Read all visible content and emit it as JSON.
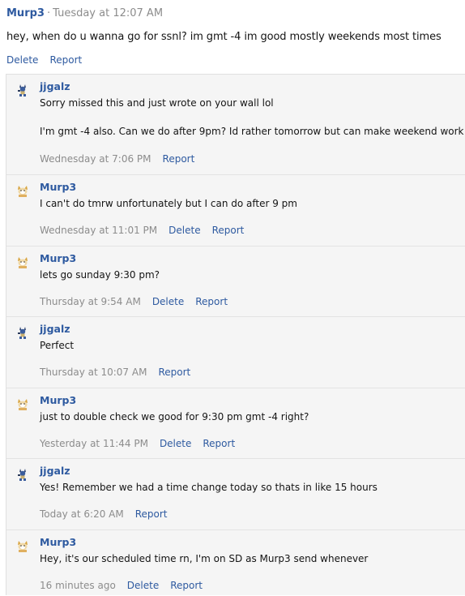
{
  "post": {
    "author": "Murp3",
    "separator": "·",
    "time": "Tuesday at 12:07 AM",
    "body": "hey, when do u wanna go for ssnl? im gmt -4 im good mostly weekends most times",
    "delete_label": "Delete",
    "report_label": "Report"
  },
  "comments": [
    {
      "author": "jjgalz",
      "avatar_icon": "lucario-avatar-icon",
      "line1": "Sorry missed this and just wrote on your wall lol",
      "line2": "I'm gmt -4 also. Can we do after 9pm? Id rather tomorrow but can make weekend work",
      "time": "Wednesday at 7:06 PM",
      "report_label": "Report"
    },
    {
      "author": "Murp3",
      "avatar_icon": "cat-avatar-icon",
      "text": "I can't do tmrw unfortunately but I can do after 9 pm",
      "time": "Wednesday at 11:01 PM",
      "delete_label": "Delete",
      "report_label": "Report"
    },
    {
      "author": "Murp3",
      "avatar_icon": "cat-avatar-icon",
      "text": "lets go sunday 9:30 pm?",
      "time": "Thursday at 9:54 AM",
      "delete_label": "Delete",
      "report_label": "Report"
    },
    {
      "author": "jjgalz",
      "avatar_icon": "lucario-avatar-icon",
      "text": "Perfect",
      "time": "Thursday at 10:07 AM",
      "report_label": "Report"
    },
    {
      "author": "Murp3",
      "avatar_icon": "cat-avatar-icon",
      "text": "just to double check we good for 9:30 pm gmt -4 right?",
      "time": "Yesterday at 11:44 PM",
      "delete_label": "Delete",
      "report_label": "Report"
    },
    {
      "author": "jjgalz",
      "avatar_icon": "lucario-avatar-icon",
      "text": "Yes! Remember we had a time change today so thats in like 15 hours",
      "time": "Today at 6:20 AM",
      "report_label": "Report"
    },
    {
      "author": "Murp3",
      "avatar_icon": "cat-avatar-icon",
      "text": "Hey, it's our scheduled time rn, I'm on SD as Murp3 send whenever",
      "time": "16 minutes ago",
      "delete_label": "Delete",
      "report_label": "Report"
    }
  ],
  "colors": {
    "link": "#2e5aa0",
    "muted": "#8c8c8c",
    "comments_bg": "#f5f5f5"
  }
}
